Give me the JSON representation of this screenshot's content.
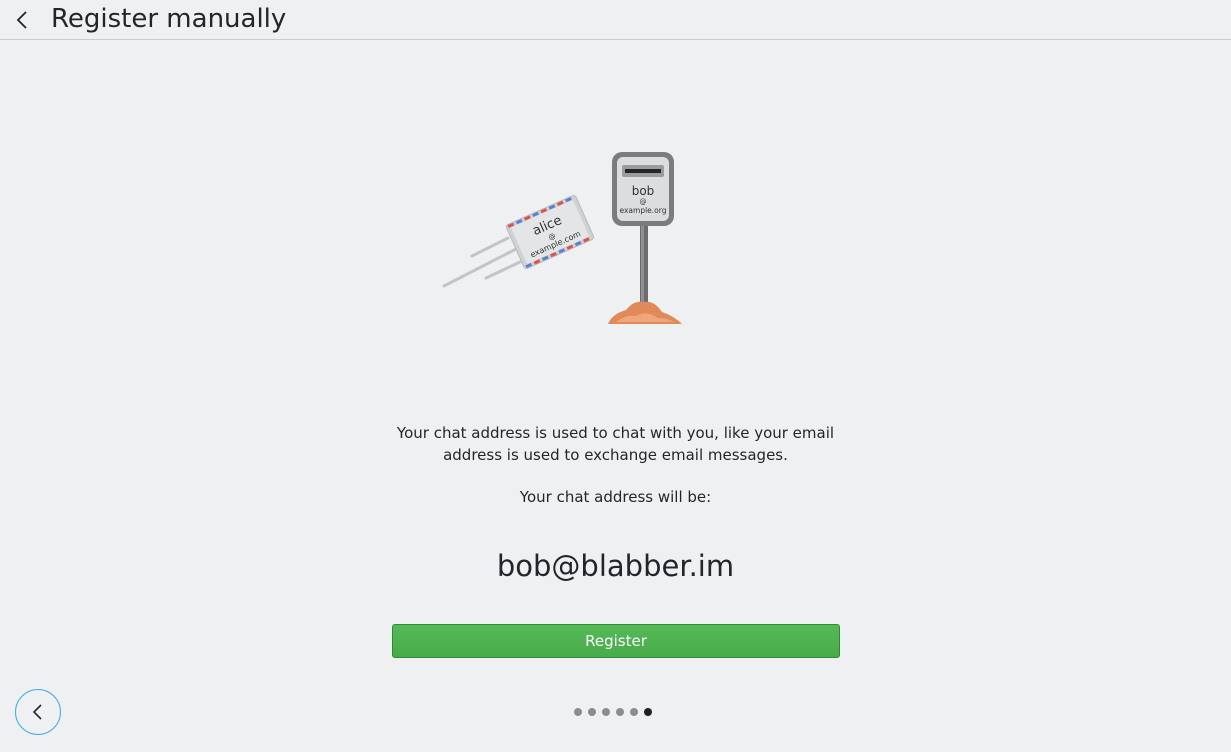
{
  "header": {
    "title": "Register manually",
    "back_icon": "chevron-left-icon"
  },
  "illustration": {
    "envelope": {
      "name": "alice",
      "at": "@",
      "domain": "example.com"
    },
    "mailbox": {
      "name": "bob",
      "at": "@",
      "domain": "example.org"
    }
  },
  "main": {
    "info_line1": "Your chat address is used to chat with you, like your email",
    "info_line2": "address is used to exchange email messages.",
    "address_label": "Your chat address will be:",
    "address": "bob@blabber.im",
    "register_label": "Register"
  },
  "footer": {
    "back_icon": "chevron-left-icon",
    "page_count": 6,
    "current_page": 6
  },
  "colors": {
    "accent": "#3daee9",
    "button_green": "#4cb14e",
    "background": "#eff0f1"
  }
}
